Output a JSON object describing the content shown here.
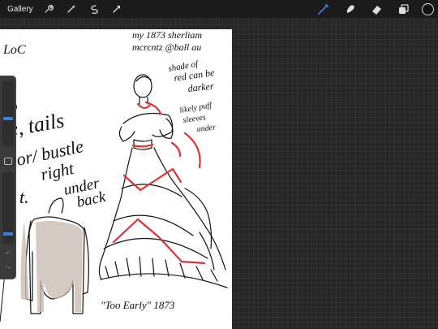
{
  "app": {
    "name": "Procreate"
  },
  "topbar": {
    "gallery_label": "Gallery",
    "left_tools": [
      "wrench-icon",
      "magic-wand-icon",
      "selection-icon",
      "transform-icon"
    ],
    "right_tools": [
      "brush-icon",
      "smudge-icon",
      "eraser-icon",
      "layers-icon"
    ],
    "active_tool": "brush-icon",
    "current_color": "#111111",
    "accent_color": "#3f7ddb"
  },
  "sidebar": {
    "size_slider_value": 0.42,
    "opacity_slider_value": 0.12
  },
  "canvas": {
    "handwritten_notes": [
      "my 1873 sherliam",
      "mcrcntz @ball au",
      "shade of",
      "red can be",
      "darker",
      "likely puff",
      "sleeves",
      "under",
      "\"Too Early\" 1873",
      "LoC",
      "e, tails",
      "or/ bustle",
      "right",
      "under",
      "back",
      "t."
    ],
    "accent_ink": "#e03030"
  }
}
